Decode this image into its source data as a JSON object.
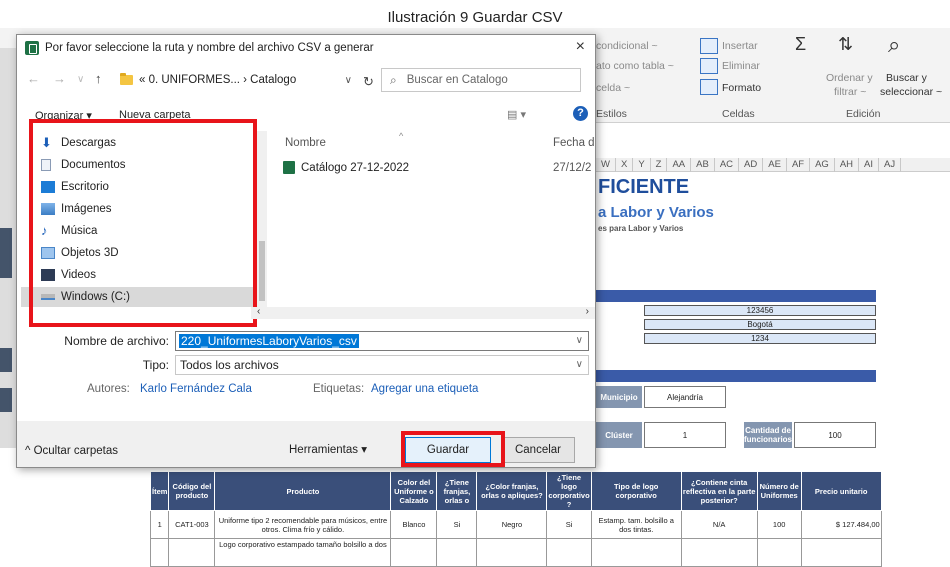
{
  "caption": "Ilustración 9 Guardar CSV",
  "excel": {
    "ribbon": {
      "conditional": "condicional ~",
      "table_format": "ato como tabla ~",
      "cell_styles": "celda ~",
      "styles_group": "Estilos",
      "insert": "Insertar",
      "delete": "Eliminar",
      "format": "Formato",
      "cells_group": "Celdas",
      "sort_filter_1": "Ordenar y",
      "sort_filter_2": "filtrar ~",
      "find_select_1": "Buscar y",
      "find_select_2": "seleccionar ~",
      "edit_group": "Edición"
    },
    "columns": [
      "W",
      "X",
      "Y",
      "Z",
      "AA",
      "AB",
      "AC",
      "AD",
      "AE",
      "AF",
      "AG",
      "AH",
      "AI",
      "AJ"
    ],
    "title": "FICIENTE",
    "subtitle": "a Labor y Varios",
    "subtitle2": "es para Labor y Varios",
    "values": {
      "v1": "123456",
      "v2": "Bogotá",
      "v3": "1234"
    },
    "municipio_label": "Municipio",
    "municipio_value": "Alejandría",
    "cluster_label": "Clúster",
    "cluster_value": "1",
    "cantidad_label": "Cantidad de funcionarios",
    "cantidad_value": "100",
    "table_headers": [
      "Ítem",
      "Código del producto",
      "Producto",
      "Color del Uniforme o Calzado",
      "¿Tiene franjas, orlas o",
      "¿Color franjas, orlas o apliques?",
      "¿Tiene logo corporativo ?",
      "Tipo de logo corporativo",
      "¿Contiene cinta reflectiva en la parte posterior?",
      "Número de Uniformes",
      "Precio unitario"
    ],
    "table_rows": [
      [
        "1",
        "CAT1-003",
        "Uniforme tipo 2 recomendable para músicos, entre otros. Clima frío y cálido.",
        "Blanco",
        "Si",
        "Negro",
        "Si",
        "Estamp. tam. bolsillo a dos tintas.",
        "N/A",
        "100",
        "$ 127.484,00"
      ]
    ],
    "table_row2_partial": "Logo corporativo estampado tamaño bolsillo a dos"
  },
  "dialog": {
    "title": "Por favor seleccione la ruta y nombre del archivo CSV a generar",
    "close": "×",
    "address": "« 0. UNIFORMES... › Catalogo",
    "search_placeholder": "Buscar en Catalogo",
    "organize": "Organizar ▾",
    "new_folder": "Nueva carpeta",
    "help": "?",
    "nav_items": [
      {
        "label": "Descargas",
        "icon": "download-icon"
      },
      {
        "label": "Documentos",
        "icon": "document-icon"
      },
      {
        "label": "Escritorio",
        "icon": "desktop-icon"
      },
      {
        "label": "Imágenes",
        "icon": "images-icon"
      },
      {
        "label": "Música",
        "icon": "music-icon"
      },
      {
        "label": "Objetos 3D",
        "icon": "cube-icon"
      },
      {
        "label": "Videos",
        "icon": "video-icon"
      },
      {
        "label": "Windows (C:)",
        "icon": "drive-icon"
      }
    ],
    "col_name": "Nombre",
    "col_date": "Fecha d",
    "file": {
      "name": "Catálogo 27-12-2022",
      "date": "27/12/2"
    },
    "filename_label": "Nombre de archivo:",
    "filename_value": "220_UniformesLaboryVarios_csv",
    "type_label": "Tipo:",
    "type_value": "Todos los archivos",
    "authors_label": "Autores:",
    "authors_value": "Karlo Fernández Cala",
    "tags_label": "Etiquetas:",
    "tags_value": "Agregar una etiqueta",
    "hide_folders": "^ Ocultar carpetas",
    "tools": "Herramientas ▾",
    "save": "Guardar",
    "cancel": "Cancelar"
  },
  "colors": {
    "highlight": "#e8141a",
    "accent": "#0078d7",
    "excel_blue": "#1f4e9c"
  }
}
